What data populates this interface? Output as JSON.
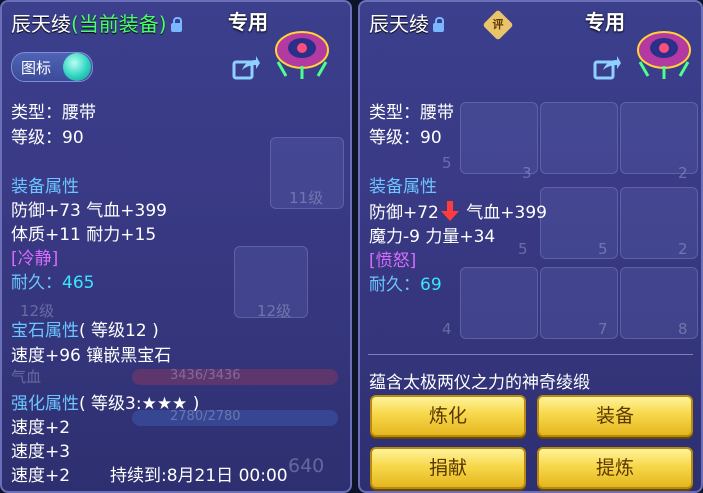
{
  "left_panel": {
    "title": "辰天绫",
    "title_status": "(当前装备)",
    "exclusive": "专用",
    "icon_toggle_label": "图标",
    "type": "类型：腰带",
    "level": "等级：90",
    "equip_header": "装备属性",
    "attr_line1": "防御+73 气血+399",
    "attr_line2": "体质+11 耐力+15",
    "special": "[冷静]",
    "durability_label": "耐久：",
    "durability_value": "465",
    "gem_header": "宝石属性",
    "gem_level": "( 等级12 )",
    "gem_line": "速度+96 镶嵌黑宝石",
    "enhance_header": "强化属性",
    "enhance_level": "( 等级3:★★★ )",
    "enhance_line1": "速度+2",
    "enhance_line2": "速度+3",
    "enhance_line3": "速度+2",
    "duration": "持续到:8月21日 00:00",
    "background": {
      "level_11": "11级",
      "level_12a": "12级",
      "level_12b": "12级",
      "hp_label": "气血",
      "hp_value": "3436/3436",
      "mp_value": "2780/2780",
      "stat_value": "640"
    }
  },
  "right_panel": {
    "title": "辰天绫",
    "rate_badge": "评",
    "exclusive": "专用",
    "type": "类型：腰带",
    "level": "等级：90",
    "equip_header": "装备属性",
    "attr_line1a": "防御+72",
    "attr_line1b": " 气血+399",
    "attr_line2": "魔力-9 力量+34",
    "special": "[愤怒]",
    "durability_label": "耐久：",
    "durability_value": "69",
    "description": "蕴含太极两仪之力的神奇绫缎",
    "buttons": {
      "refine": "炼化",
      "equip": "装备",
      "donate": "捐献",
      "extract": "提炼"
    },
    "background_numbers": [
      "5",
      "3",
      "2",
      "5",
      "5",
      "2",
      "4",
      "7",
      "8"
    ]
  },
  "colors": {
    "accent_blue": "#6bc6ff",
    "current_green": "#46ff6a",
    "special_purple": "#d96bff",
    "durability_cyan": "#39e6ff",
    "button_gold": "#f7d84b",
    "downgrade_red": "#ff3b3b"
  },
  "icons": [
    "lock-icon",
    "share-icon",
    "mask-item-icon",
    "toggle-knob-icon",
    "arrow-down-icon"
  ]
}
